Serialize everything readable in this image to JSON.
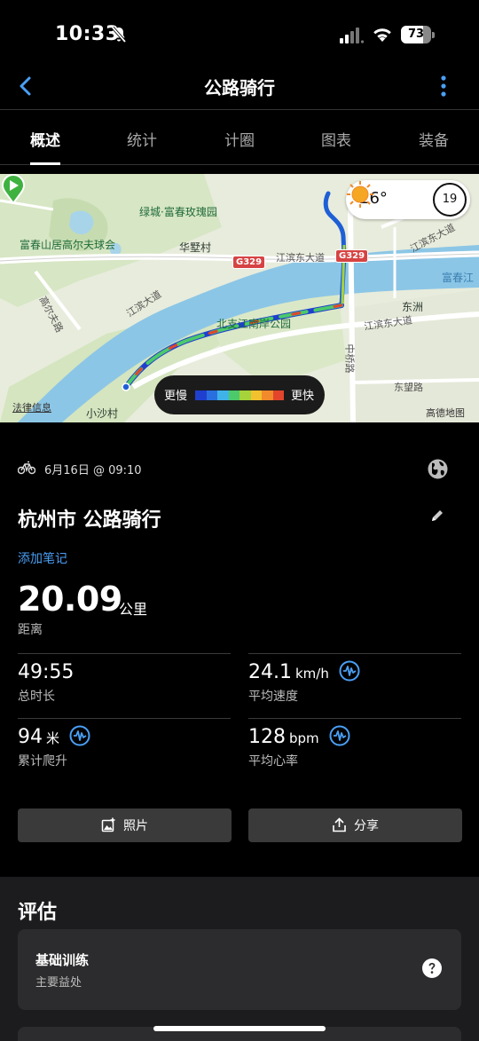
{
  "status_bar": {
    "time": "10:33",
    "battery": "73",
    "battery_level": 0.73
  },
  "nav": {
    "title": "公路骑行",
    "back_icon": "chevron-left-icon",
    "more_icon": "more-vertical-icon",
    "accent_color": "#4a9ff5"
  },
  "tabs": [
    {
      "label": "概述",
      "active": true
    },
    {
      "label": "统计",
      "active": false
    },
    {
      "label": "计圈",
      "active": false
    },
    {
      "label": "图表",
      "active": false
    },
    {
      "label": "装备",
      "active": false
    }
  ],
  "map": {
    "labels": {
      "lvcheng": "绿城·富春玫瑰园",
      "golf": "富春山居高尔夫球会",
      "huashu": "华墅村",
      "jiangbin_east_1": "江滨东大道",
      "jiangbin_east_2": "江滨东大道",
      "jiangbin_east_3": "江滨东大道",
      "fuchunjiang": "富春江",
      "dongzhou": "东洲",
      "beizhi_park": "北支江南岸公园",
      "gaoer_road": "高尔夫路",
      "zhongqiao_road": "中桥路",
      "dongwang_road": "东望路",
      "xiaosha": "小沙村",
      "jiangbin_west": "江滨大道"
    },
    "shields": [
      "G329",
      "G329"
    ],
    "weather": {
      "temperature": "26°",
      "icon": "sun-icon",
      "wind": "19"
    },
    "legend": {
      "slow": "更慢",
      "fast": "更快",
      "colors": [
        "#1f3fcf",
        "#2a6fe0",
        "#3fb3e8",
        "#4cc96a",
        "#a6d23a",
        "#f2c12e",
        "#f08a2a",
        "#e2452b"
      ]
    },
    "attribution_left": "法律信息",
    "attribution_right": "高德地图"
  },
  "activity": {
    "type_icon": "bike-icon",
    "date": "6月16日 @ 09:10",
    "name": "杭州市 公路骑行",
    "add_note": "添加笔记"
  },
  "distance": {
    "value": "20.09",
    "unit": "公里",
    "label": "距离"
  },
  "stats": [
    {
      "value": "49:55",
      "unit": "",
      "label": "总时长",
      "has_chart_icon": false
    },
    {
      "value": "24.1",
      "unit": "km/h",
      "label": "平均速度",
      "has_chart_icon": true
    },
    {
      "value": "94",
      "unit": "米",
      "label": "累计爬升",
      "has_chart_icon": true
    },
    {
      "value": "128",
      "unit": "bpm",
      "label": "平均心率",
      "has_chart_icon": true
    }
  ],
  "actions": {
    "photos": "照片",
    "share": "分享"
  },
  "evaluation": {
    "title": "评估",
    "card_title": "基础训练",
    "card_subtitle": "主要益处"
  }
}
